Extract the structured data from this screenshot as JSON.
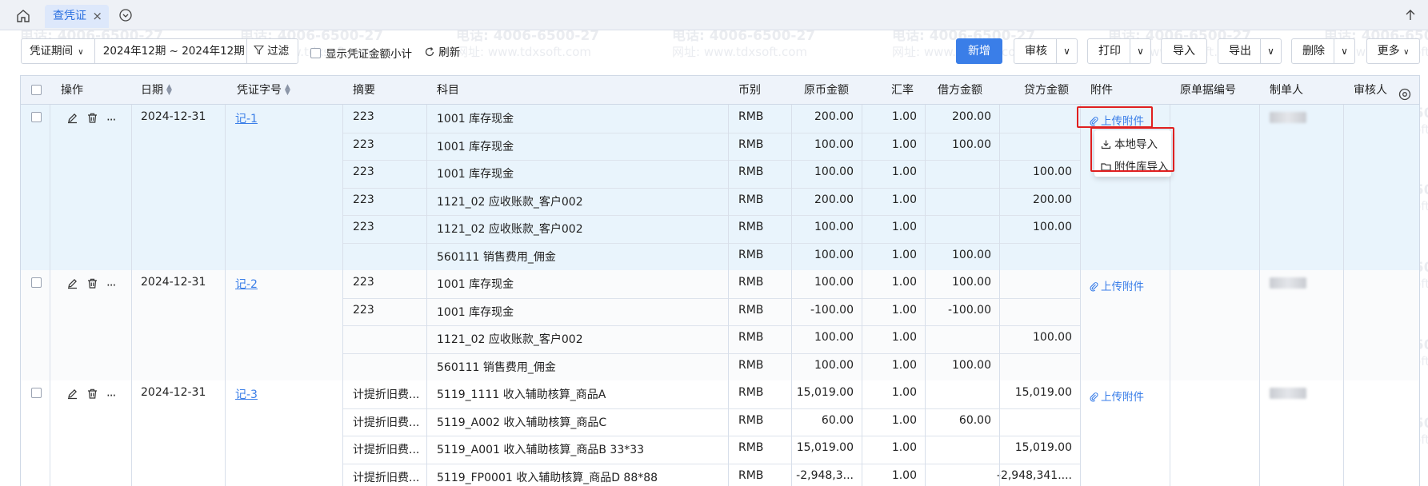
{
  "tabbar": {
    "tab_label": "查凭证",
    "tab_close": "×"
  },
  "toolbar": {
    "period_select": "凭证期间",
    "period_range": "2024年12期  ~ 2024年12期",
    "filter_label": "过滤",
    "show_subtotal": "显示凭证金额小计",
    "refresh_label": "刷新",
    "new_label": "新增",
    "review_label": "审核",
    "print_label": "打印",
    "import_label": "导入",
    "export_label": "导出",
    "delete_label": "删除",
    "more_label": "更多"
  },
  "columns": {
    "action": "操作",
    "date": "日期",
    "voucher_no": "凭证字号",
    "summary": "摘要",
    "account": "科目",
    "currency": "币别",
    "orig_amount": "原币金额",
    "rate": "汇率",
    "debit": "借方金额",
    "credit": "贷方金额",
    "attachment": "附件",
    "orig_doc_no": "原单据编号",
    "preparer": "制单人",
    "reviewer": "审核人"
  },
  "ellipsis": "···",
  "upload_label": "上传附件",
  "popup": {
    "local_import": "本地导入",
    "library_import": "附件库导入"
  },
  "vouchers": [
    {
      "date": "2024-12-31",
      "no": "记-1",
      "lines": [
        {
          "summary": "223",
          "account": "1001 库存现金",
          "currency": "RMB",
          "orig": "200.00",
          "rate": "1.00",
          "debit": "200.00",
          "credit": ""
        },
        {
          "summary": "223",
          "account": "1001 库存现金",
          "currency": "RMB",
          "orig": "100.00",
          "rate": "1.00",
          "debit": "100.00",
          "credit": ""
        },
        {
          "summary": "223",
          "account": "1001 库存现金",
          "currency": "RMB",
          "orig": "100.00",
          "rate": "1.00",
          "debit": "",
          "credit": "100.00"
        },
        {
          "summary": "223",
          "account": "1121_02 应收账款_客户002",
          "currency": "RMB",
          "orig": "200.00",
          "rate": "1.00",
          "debit": "",
          "credit": "200.00"
        },
        {
          "summary": "223",
          "account": "1121_02 应收账款_客户002",
          "currency": "RMB",
          "orig": "100.00",
          "rate": "1.00",
          "debit": "",
          "credit": "100.00"
        },
        {
          "summary": "",
          "account": "560111 销售费用_佣金",
          "currency": "RMB",
          "orig": "100.00",
          "rate": "1.00",
          "debit": "100.00",
          "credit": ""
        }
      ]
    },
    {
      "date": "2024-12-31",
      "no": "记-2",
      "lines": [
        {
          "summary": "223",
          "account": "1001 库存现金",
          "currency": "RMB",
          "orig": "100.00",
          "rate": "1.00",
          "debit": "100.00",
          "credit": ""
        },
        {
          "summary": "223",
          "account": "1001 库存现金",
          "currency": "RMB",
          "orig": "-100.00",
          "rate": "1.00",
          "debit": "-100.00",
          "credit": ""
        },
        {
          "summary": "",
          "account": "1121_02 应收账款_客户002",
          "currency": "RMB",
          "orig": "100.00",
          "rate": "1.00",
          "debit": "",
          "credit": "100.00"
        },
        {
          "summary": "",
          "account": "560111 销售费用_佣金",
          "currency": "RMB",
          "orig": "100.00",
          "rate": "1.00",
          "debit": "100.00",
          "credit": ""
        }
      ]
    },
    {
      "date": "2024-12-31",
      "no": "记-3",
      "lines": [
        {
          "summary": "计提折旧费...",
          "account": "5119_1111 收入辅助核算_商品A",
          "currency": "RMB",
          "orig": "15,019.00",
          "rate": "1.00",
          "debit": "",
          "credit": "15,019.00"
        },
        {
          "summary": "计提折旧费...",
          "account": "5119_A002 收入辅助核算_商品C",
          "currency": "RMB",
          "orig": "60.00",
          "rate": "1.00",
          "debit": "60.00",
          "credit": ""
        },
        {
          "summary": "计提折旧费...",
          "account": "5119_A001 收入辅助核算_商品B 33*33",
          "currency": "RMB",
          "orig": "15,019.00",
          "rate": "1.00",
          "debit": "",
          "credit": "15,019.00"
        },
        {
          "summary": "计提折旧费...",
          "account": "5119_FP0001 收入辅助核算_商品D 88*88",
          "currency": "RMB",
          "orig": "-2,948,3...",
          "rate": "1.00",
          "debit": "",
          "credit": "-2,948,341...."
        }
      ]
    }
  ],
  "watermark": {
    "phone": "电话: 4006-6500-27",
    "site": "网址: www.tdxsoft.com"
  }
}
